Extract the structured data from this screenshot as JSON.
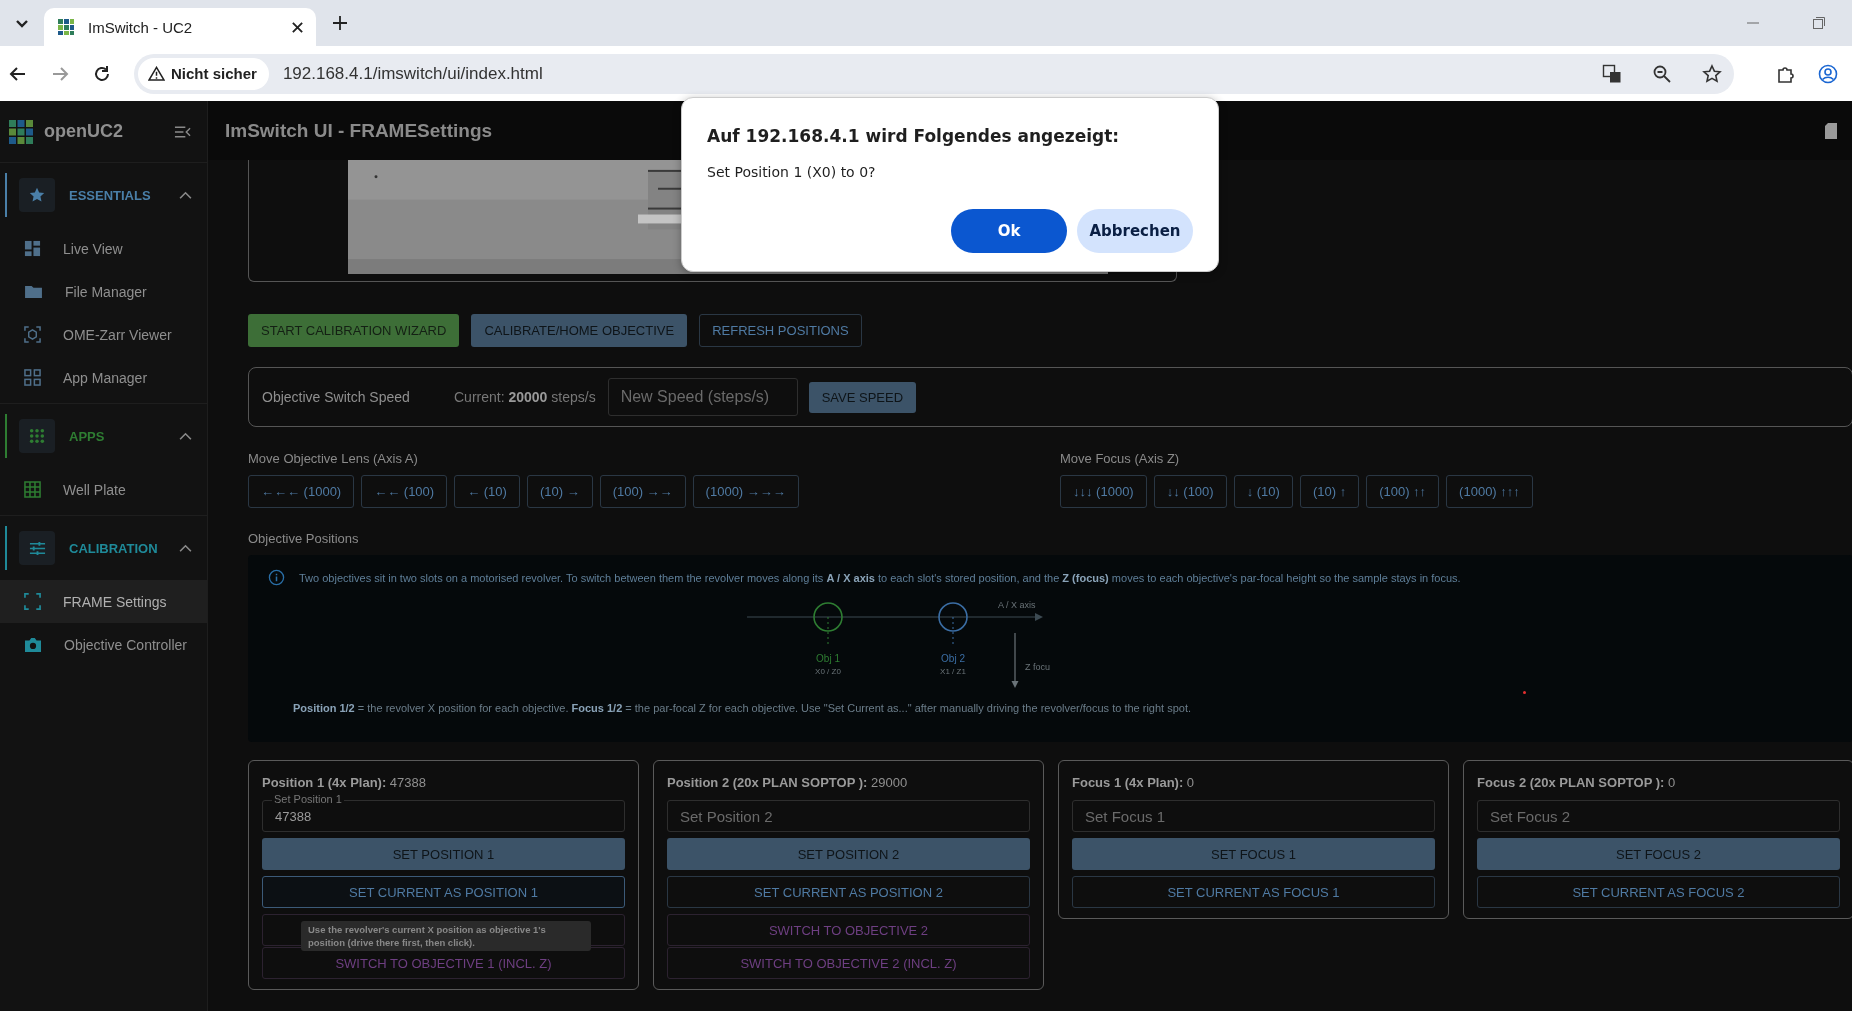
{
  "browser": {
    "tabs": [
      {
        "title": "ImSwitch - UC2",
        "selected": true
      }
    ],
    "security_label": "Nicht sicher",
    "url": "192.168.4.1/imswitch/ui/index.html"
  },
  "sidebar": {
    "brand": "openUC2",
    "sections": [
      {
        "title": "ESSENTIALS",
        "color": "#4a7fa8",
        "expanded": true,
        "items": [
          {
            "label": "Live View",
            "selected": false
          },
          {
            "label": "File Manager",
            "selected": false
          },
          {
            "label": "OME-Zarr Viewer",
            "selected": false
          },
          {
            "label": "App Manager",
            "selected": false
          }
        ]
      },
      {
        "title": "APPS",
        "color": "#2e7d32",
        "expanded": true,
        "items": [
          {
            "label": "Well Plate",
            "selected": false
          }
        ]
      },
      {
        "title": "CALIBRATION",
        "color": "#1f8a99",
        "expanded": true,
        "items": [
          {
            "label": "FRAME Settings",
            "selected": true
          },
          {
            "label": "Objective Controller",
            "selected": false
          }
        ]
      }
    ]
  },
  "header": {
    "title": "ImSwitch UI - FRAMESettings"
  },
  "actions": [
    {
      "label": "START CALIBRATION WIZARD",
      "kind": "success"
    },
    {
      "label": "CALIBRATE/HOME OBJECTIVE",
      "kind": "primary"
    },
    {
      "label": "REFRESH POSITIONS",
      "kind": "outlined"
    }
  ],
  "speed": {
    "label": "Objective Switch Speed",
    "current": "Current: **20000** steps/s",
    "placeholder": "New Speed (steps/s)",
    "button": "SAVE SPEED"
  },
  "moves": [
    {
      "label": "Move Objective Lens (Axis A)",
      "buttons": [
        "←←← (1000)",
        "←← (100)",
        "← (10)",
        "(10) →",
        "(100) →→",
        "(1000) →→→"
      ]
    },
    {
      "label": "Move Focus (Axis Z)",
      "buttons": [
        "↓↓↓ (1000)",
        "↓↓ (100)",
        "↓ (10)",
        "(10) ↑",
        "(100) ↑↑",
        "(1000) ↑↑↑"
      ]
    }
  ],
  "positions": {
    "label": "Objective Positions",
    "info": "Two objectives sit in two slots on a motorised revolver. To switch between them the revolver moves along its **A / X axis** to each slot's stored position, and the **Z (focus)** moves to each objective's par-focal height so the sample stays in focus.",
    "diagram": {
      "axis_label": "A / X axis",
      "focus_label": "Z focu",
      "objectives": [
        {
          "name": "Obj 1",
          "coords": "X0 / Z0",
          "color": "#2e7d32"
        },
        {
          "name": "Obj 2",
          "coords": "X1 / Z1",
          "color": "#3b6ea5"
        }
      ]
    },
    "note": "**Position 1/2** = the revolver X position for each objective. **Focus 1/2** = the par-focal Z for each objective. Use \"Set Current as...\" after manually driving the revolver/focus to the right spot."
  },
  "cards": [
    {
      "title": "Position 1 (4x Plan):",
      "value": "47388",
      "field": {
        "label": "Set Position 1",
        "value": "47388"
      },
      "buttons": [
        {
          "label": "SET POSITION 1",
          "kind": "primary",
          "focused": false
        },
        {
          "label": "SET CURRENT AS POSITION 1",
          "kind": "outlined",
          "focused": true
        },
        {
          "kind": "switch",
          "focused": false
        },
        {
          "label": "SWITCH TO OBJECTIVE 1 (INCL. Z)",
          "kind": "switch",
          "focused": false
        }
      ],
      "tooltip": "Use the revolver's current X position as objective 1's position (drive there first, then click)."
    },
    {
      "title": "Position 2 (20x PLAN SOPTOP ):",
      "value": "29000",
      "field": {
        "placeholder": "Set Position 2"
      },
      "buttons": [
        {
          "label": "SET POSITION 2",
          "kind": "primary",
          "focused": false
        },
        {
          "label": "SET CURRENT AS POSITION 2",
          "kind": "outlined",
          "focused": false
        },
        {
          "label": "SWITCH TO OBJECTIVE 2",
          "kind": "switch",
          "focused": false
        },
        {
          "label": "SWITCH TO OBJECTIVE 2 (INCL. Z)",
          "kind": "switch",
          "focused": false
        }
      ]
    },
    {
      "title": "Focus 1 (4x Plan):",
      "value": "0",
      "field": {
        "placeholder": "Set Focus 1"
      },
      "buttons": [
        {
          "label": "SET FOCUS 1",
          "kind": "primary",
          "focused": false
        },
        {
          "label": "SET CURRENT AS FOCUS 1",
          "kind": "outlined",
          "focused": false
        }
      ]
    },
    {
      "title": "Focus 2 (20x PLAN SOPTOP ):",
      "value": "0",
      "field": {
        "placeholder": "Set Focus 2"
      },
      "buttons": [
        {
          "label": "SET FOCUS 2",
          "kind": "primary",
          "focused": false
        },
        {
          "label": "SET CURRENT AS FOCUS 2",
          "kind": "outlined",
          "focused": false
        }
      ]
    }
  ],
  "dialog": {
    "heading": "Auf 192.168.4.1 wird Folgendes angezeigt:",
    "message": "Set Position 1 (X0) to 0?",
    "buttons": [
      {
        "label": "Ok",
        "kind": "primary"
      },
      {
        "label": "Abbrechen",
        "kind": "secondary"
      }
    ]
  }
}
